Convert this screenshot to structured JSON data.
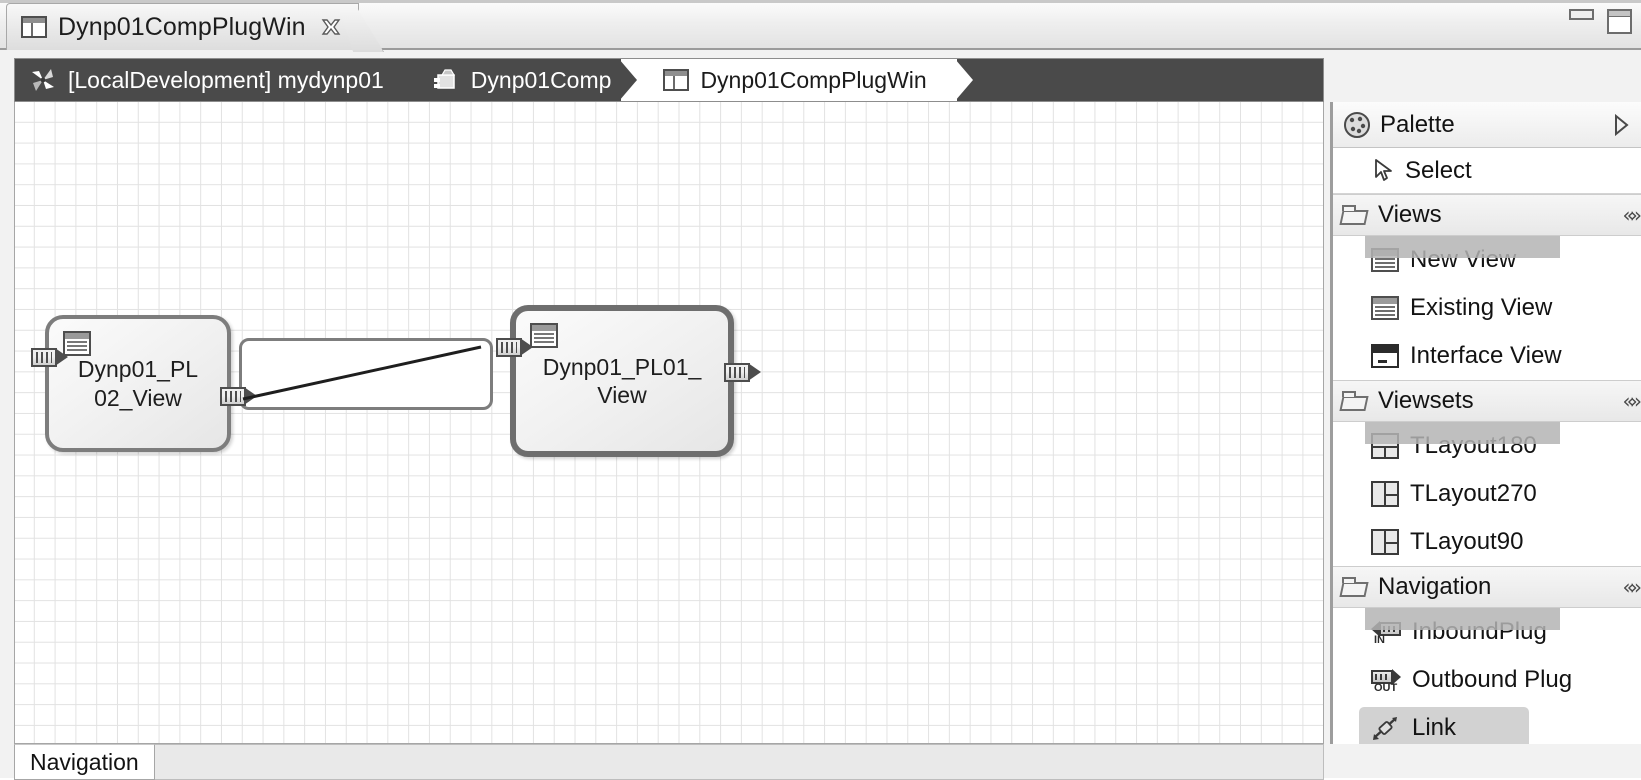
{
  "window": {
    "minimize_title": "Minimize",
    "maximize_title": "Maximize"
  },
  "editor_tab": {
    "title": "Dynp01CompPlugWin",
    "icon": "view-window-icon",
    "close_label": "✕"
  },
  "breadcrumb": {
    "items": [
      {
        "label": "[LocalDevelopment] mydynp01",
        "icon": "project-pinwheel-icon",
        "active": false
      },
      {
        "label": "Dynp01Comp",
        "icon": "component-icon",
        "active": false
      },
      {
        "label": "Dynp01CompPlugWin",
        "icon": "view-window-icon",
        "active": true
      }
    ]
  },
  "canvas": {
    "nodes": [
      {
        "id": "node-left",
        "label": "Dynp01_PL\n02_View",
        "selected": false
      },
      {
        "id": "node-right",
        "label": "Dynp01_PL01_\nView",
        "selected": true
      }
    ],
    "drag_feedback": {
      "visible": true
    },
    "link_in_progress": {
      "visible": true
    }
  },
  "bottom_tabs": {
    "items": [
      {
        "label": "Navigation",
        "active": true
      }
    ]
  },
  "palette": {
    "title": "Palette",
    "icon": "palette-icon",
    "expand_label": "▷",
    "tool": {
      "label": "Select",
      "icon": "cursor-arrow-icon"
    },
    "collapse_glyph": "«",
    "groups": [
      {
        "title": "Views",
        "icon": "folder-open-icon",
        "items": [
          {
            "label": "New View",
            "icon": "new-view-icon",
            "state": "scrolled"
          },
          {
            "label": "Existing View",
            "icon": "existing-view-icon",
            "state": "normal"
          },
          {
            "label": "Interface View",
            "icon": "interface-view-icon",
            "state": "normal"
          }
        ]
      },
      {
        "title": "Viewsets",
        "icon": "folder-open-icon",
        "items": [
          {
            "label": "TLayout180",
            "icon": "layout180-icon",
            "state": "scrolled"
          },
          {
            "label": "TLayout270",
            "icon": "layout270-icon",
            "state": "normal"
          },
          {
            "label": "TLayout90",
            "icon": "layout90-icon",
            "state": "normal"
          }
        ]
      },
      {
        "title": "Navigation",
        "icon": "folder-open-icon",
        "items": [
          {
            "label": "InboundPlug",
            "icon": "inbound-plug-icon",
            "state": "scrolled"
          },
          {
            "label": "Outbound Plug",
            "icon": "outbound-plug-icon",
            "state": "normal"
          },
          {
            "label": "Link",
            "icon": "link-icon",
            "state": "selected"
          }
        ]
      }
    ]
  },
  "colors": {
    "breadcrumb_bg": "#4a4a4a",
    "breadcrumb_active_bg": "#ffffff",
    "canvas_grid": "#e2e2e2",
    "node_border": "#7d7d7d",
    "selection": "#d2d2d2"
  }
}
